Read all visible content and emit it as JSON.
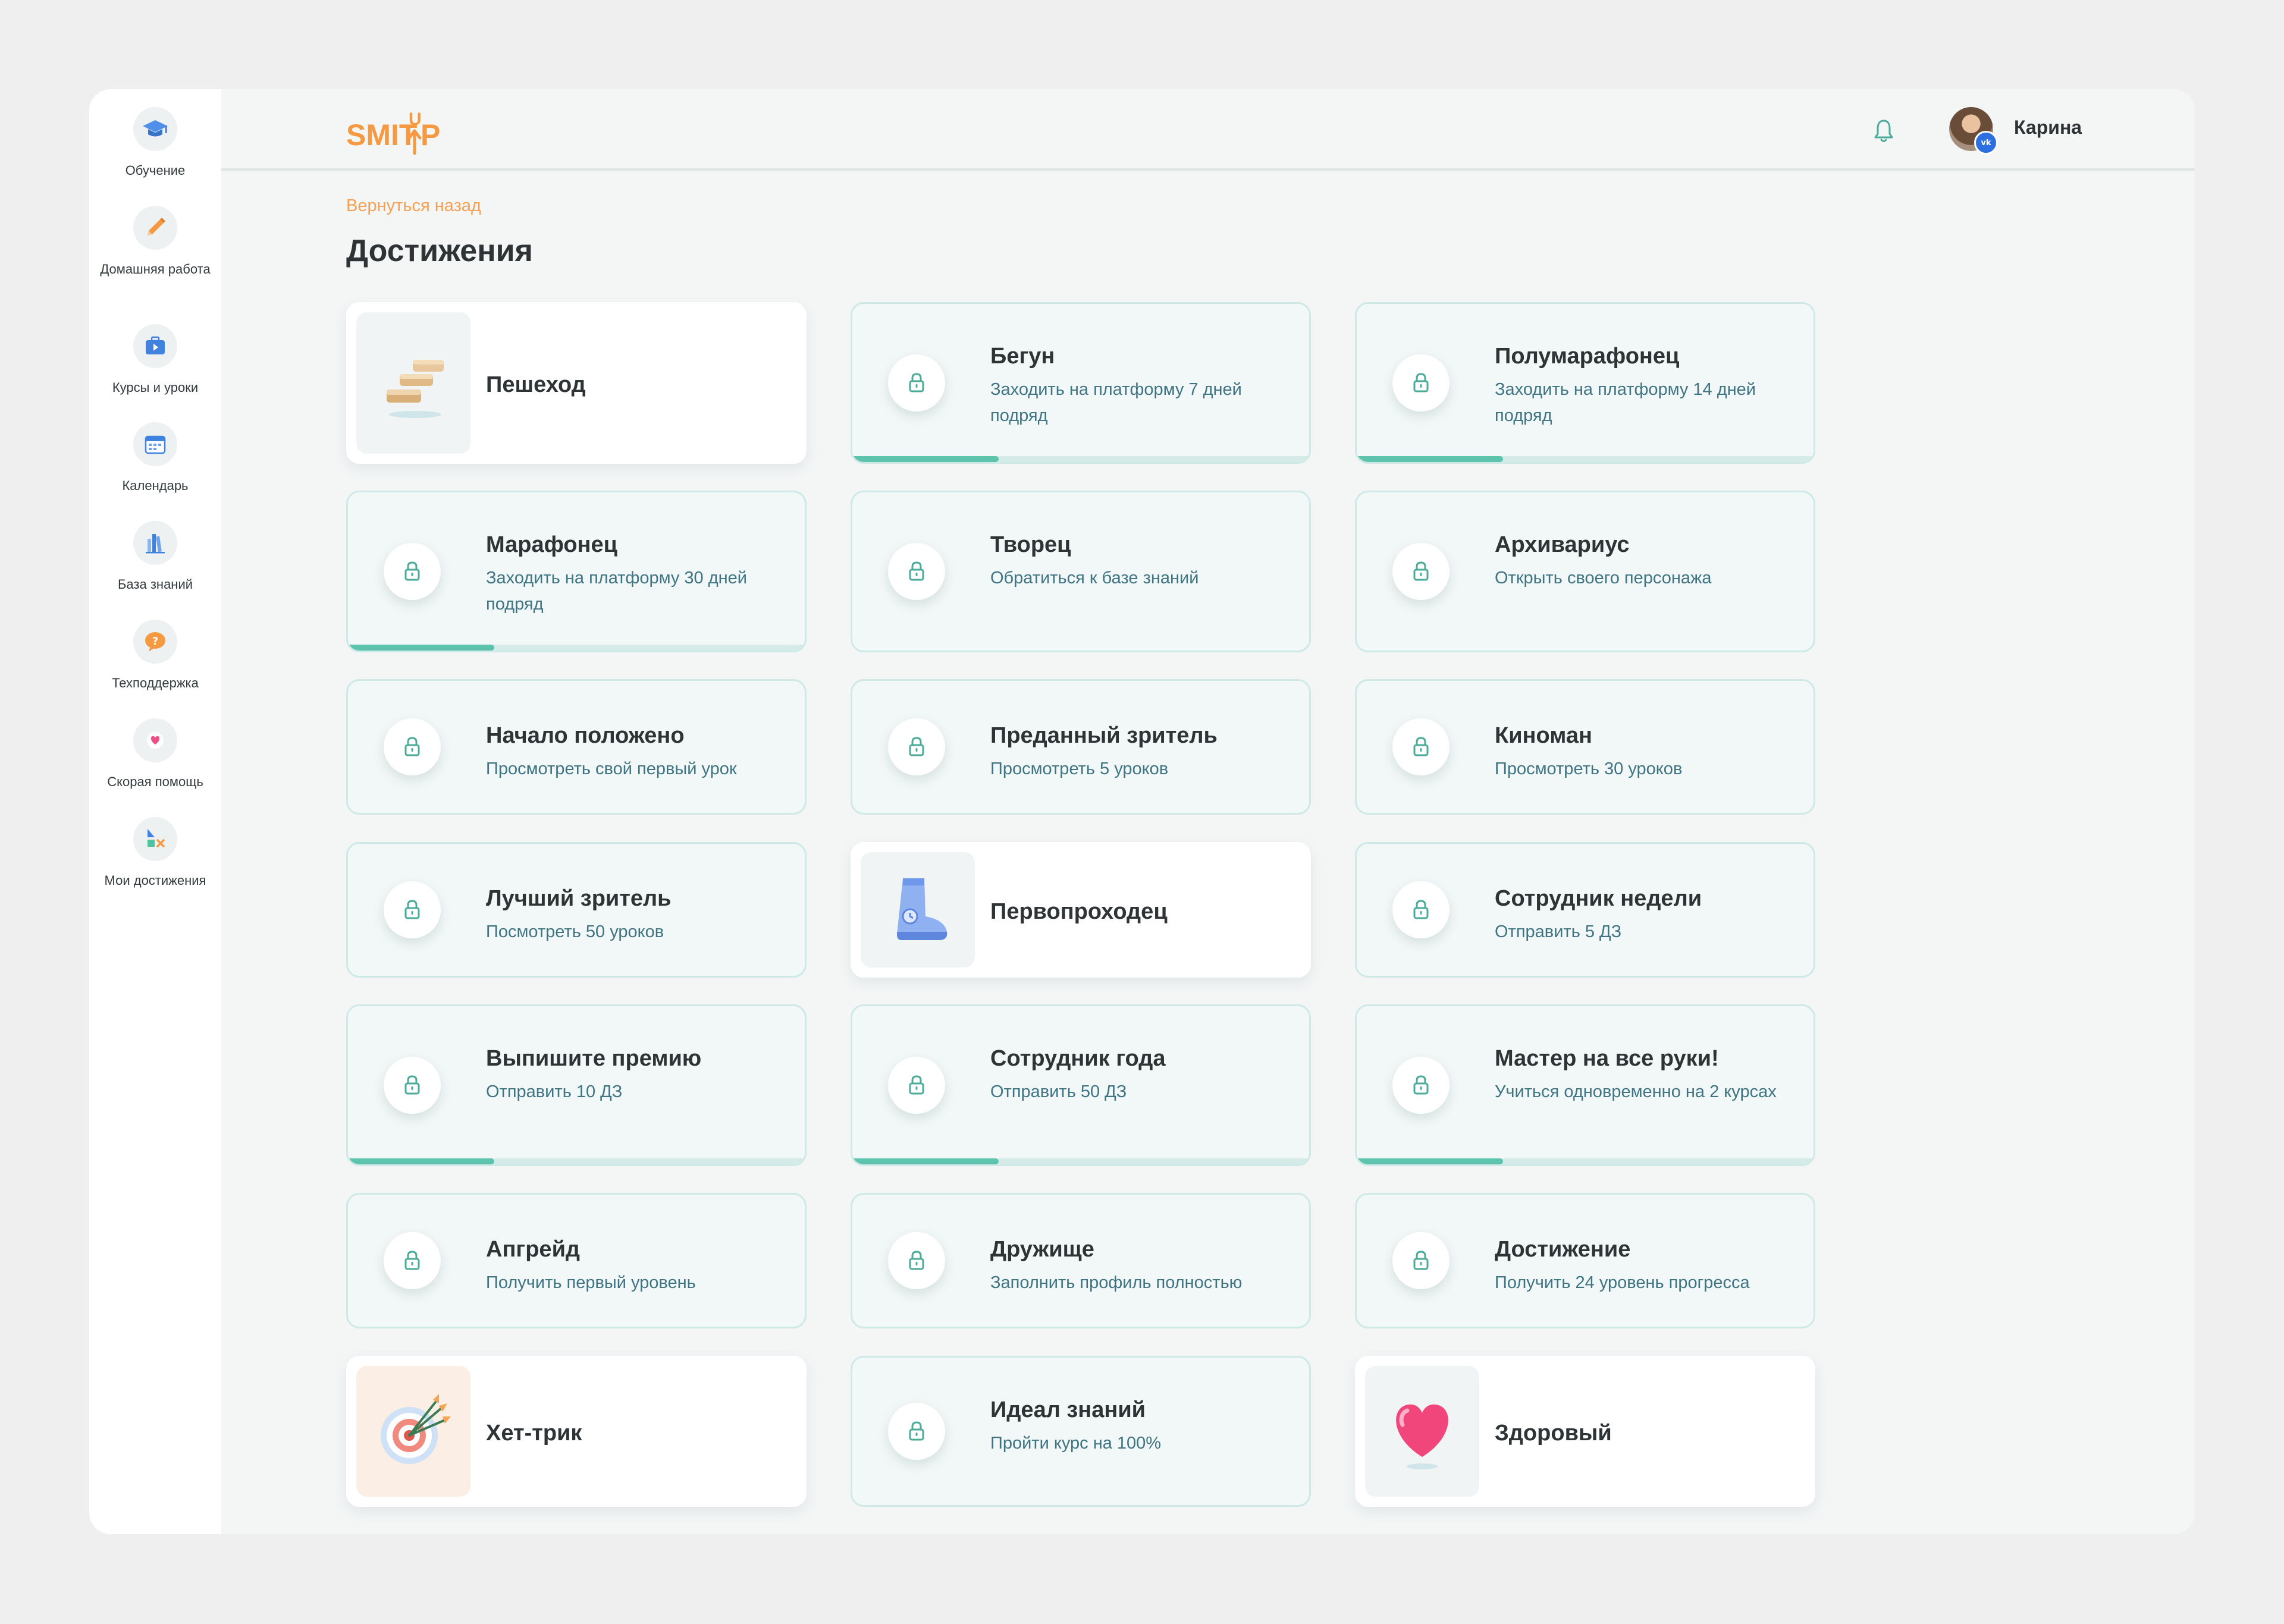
{
  "sidebar": {
    "items": [
      {
        "label": "Обучение",
        "icon": "graduation-cap-icon"
      },
      {
        "label": "Домашняя работа",
        "icon": "pencil-icon"
      },
      {
        "label": "Курсы и уроки",
        "icon": "course-briefcase-icon"
      },
      {
        "label": "Календарь",
        "icon": "calendar-icon"
      },
      {
        "label": "База знаний",
        "icon": "books-icon"
      },
      {
        "label": "Техподдержка",
        "icon": "question-bubble-icon"
      },
      {
        "label": "Скорая помощь",
        "icon": "heart-icon"
      },
      {
        "label": "Мои достижения",
        "icon": "shapes-icon"
      }
    ]
  },
  "header": {
    "logo_text": "SMITUP",
    "user_name": "Карина"
  },
  "main": {
    "back_link": "Вернуться назад",
    "title": "Достижения"
  },
  "achievements": [
    {
      "title": "Пешеход",
      "desc": "",
      "unlocked": true,
      "image": "bricks-icon",
      "progress": null
    },
    {
      "title": "Бегун",
      "desc": "Заходить на платформу 7 дней подряд",
      "unlocked": false,
      "image": "lock-icon",
      "progress": 0.32
    },
    {
      "title": "Полумарафонец",
      "desc": "Заходить на платформу 14 дней подряд",
      "unlocked": false,
      "image": "lock-icon",
      "progress": 0.32
    },
    {
      "title": "Марафонец",
      "desc": "Заходить на платформу 30 дней подряд",
      "unlocked": false,
      "image": "lock-icon",
      "progress": 0.32
    },
    {
      "title": "Творец",
      "desc": "Обратиться к базе знаний",
      "unlocked": false,
      "image": "lock-icon",
      "progress": null
    },
    {
      "title": "Архивариус",
      "desc": "Открыть своего персонажа",
      "unlocked": false,
      "image": "lock-icon",
      "progress": null
    },
    {
      "title": "Начало положено",
      "desc": "Просмотреть свой первый урок",
      "unlocked": false,
      "image": "lock-icon",
      "progress": null
    },
    {
      "title": "Преданный зритель",
      "desc": "Просмотреть 5 уроков",
      "unlocked": false,
      "image": "lock-icon",
      "progress": null
    },
    {
      "title": "Киноман",
      "desc": "Просмотреть 30 уроков",
      "unlocked": false,
      "image": "lock-icon",
      "progress": null
    },
    {
      "title": "Лучший зритель",
      "desc": "Посмотреть 50 уроков",
      "unlocked": false,
      "image": "lock-icon",
      "progress": null
    },
    {
      "title": "Первопроходец",
      "desc": "",
      "unlocked": true,
      "image": "boot-icon",
      "progress": null
    },
    {
      "title": "Сотрудник недели",
      "desc": "Отправить 5 ДЗ",
      "unlocked": false,
      "image": "lock-icon",
      "progress": null
    },
    {
      "title": "Выпишите премию",
      "desc": "Отправить 10 ДЗ",
      "unlocked": false,
      "image": "lock-icon",
      "progress": 0.32
    },
    {
      "title": "Сотрудник года",
      "desc": "Отправить 50 ДЗ",
      "unlocked": false,
      "image": "lock-icon",
      "progress": 0.32
    },
    {
      "title": "Мастер на все руки!",
      "desc": "Учиться одновременно на 2 курсах",
      "unlocked": false,
      "image": "lock-icon",
      "progress": 0.32
    },
    {
      "title": "Апгрейд",
      "desc": "Получить первый уровень",
      "unlocked": false,
      "image": "lock-icon",
      "progress": null
    },
    {
      "title": "Дружище",
      "desc": "Заполнить профиль полностью",
      "unlocked": false,
      "image": "lock-icon",
      "progress": null
    },
    {
      "title": "Достижение",
      "desc": "Получить 24 уровень прогресса",
      "unlocked": false,
      "image": "lock-icon",
      "progress": null
    },
    {
      "title": "Хет-трик",
      "desc": "",
      "unlocked": true,
      "image": "target-icon",
      "progress": null
    },
    {
      "title": "Идеал знаний",
      "desc": "Пройти курс на 100%",
      "unlocked": false,
      "image": "lock-icon",
      "progress": null
    },
    {
      "title": "Здоровый",
      "desc": "",
      "unlocked": true,
      "image": "heart-icon",
      "progress": null
    }
  ],
  "colors": {
    "accent": "#f6a053",
    "teal": "#5ec3ad",
    "card_border": "#cfe9e7",
    "desc_text": "#3f7482"
  }
}
